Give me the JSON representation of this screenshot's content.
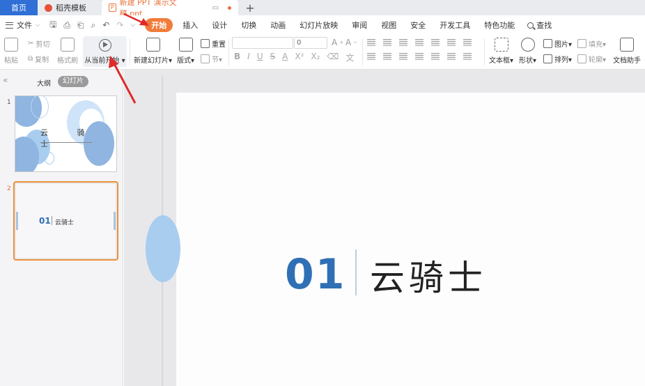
{
  "tabs": {
    "home": "首页",
    "templates": "稻壳模板",
    "document": "新建 PPT 演示文稿.ppt",
    "add": "+"
  },
  "menu": {
    "file": "文件",
    "items": [
      "开始",
      "插入",
      "设计",
      "切换",
      "动画",
      "幻灯片放映",
      "审阅",
      "视图",
      "安全",
      "开发工具",
      "特色功能"
    ],
    "active_index": 0,
    "search": "查找"
  },
  "ribbon": {
    "paste": "粘贴",
    "cut": "剪切",
    "copy": "复制",
    "format_painter": "格式刷",
    "play_from_current": "从当前开始",
    "new_slide": "新建幻灯片",
    "layout": "版式",
    "reset": "重置",
    "section": "节",
    "font_size": "0",
    "text_box": "文本框",
    "shape": "形状",
    "picture": "图片",
    "fill": "填充",
    "arrange": "排列",
    "outline": "轮廓",
    "doc_assistant": "文档助手"
  },
  "left_panel": {
    "outline_tab": "大纲",
    "slides_tab": "幻灯片",
    "slides": [
      {
        "number": "1",
        "title": "云 骑 士"
      },
      {
        "number": "2",
        "num_text": "01",
        "title": "云骑士"
      }
    ],
    "selected_index": 1
  },
  "slide": {
    "number_text": "01",
    "title": "云骑士"
  },
  "colors": {
    "accent_orange": "#f07c3a",
    "home_tab_blue": "#2f6fd6",
    "slide_number_blue": "#2f6fb5",
    "annotation_red": "#e02a2a"
  }
}
